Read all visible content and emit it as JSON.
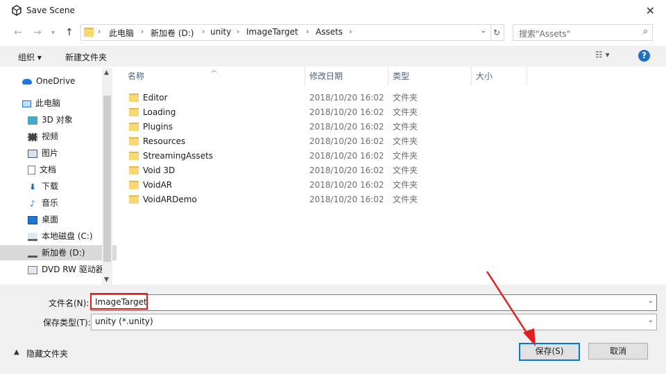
{
  "window": {
    "title": "Save Scene"
  },
  "addressbar": {
    "segments": [
      "此电脑",
      "新加卷 (D:)",
      "unity",
      "ImageTarget",
      "Assets"
    ],
    "search_placeholder": "搜索\"Assets\""
  },
  "toolbar": {
    "organize": "组织 ▾",
    "new_folder": "新建文件夹"
  },
  "sidebar": {
    "items": [
      {
        "label": "OneDrive"
      },
      {
        "label": "此电脑"
      },
      {
        "label": "3D 对象"
      },
      {
        "label": "视频"
      },
      {
        "label": "图片"
      },
      {
        "label": "文档"
      },
      {
        "label": "下载"
      },
      {
        "label": "音乐"
      },
      {
        "label": "桌面"
      },
      {
        "label": "本地磁盘 (C:)"
      },
      {
        "label": "新加卷 (D:)"
      },
      {
        "label": "DVD RW 驱动器"
      }
    ]
  },
  "list": {
    "headers": [
      "名称",
      "修改日期",
      "类型",
      "大小"
    ],
    "rows": [
      {
        "name": "Editor",
        "date": "2018/10/20 16:02",
        "type": "文件夹"
      },
      {
        "name": "Loading",
        "date": "2018/10/20 16:02",
        "type": "文件夹"
      },
      {
        "name": "Plugins",
        "date": "2018/10/20 16:02",
        "type": "文件夹"
      },
      {
        "name": "Resources",
        "date": "2018/10/20 16:02",
        "type": "文件夹"
      },
      {
        "name": "StreamingAssets",
        "date": "2018/10/20 16:02",
        "type": "文件夹"
      },
      {
        "name": "Void 3D",
        "date": "2018/10/20 16:02",
        "type": "文件夹"
      },
      {
        "name": "VoidAR",
        "date": "2018/10/20 16:02",
        "type": "文件夹"
      },
      {
        "name": "VoidARDemo",
        "date": "2018/10/20 16:02",
        "type": "文件夹"
      }
    ]
  },
  "form": {
    "filename_label": "文件名(N):",
    "filename_value": "ImageTarget",
    "filetype_label": "保存类型(T):",
    "filetype_value": "unity (*.unity)"
  },
  "footer": {
    "hide_folders": "隐藏文件夹",
    "save": "保存(S)",
    "cancel": "取消"
  },
  "colors": {
    "accent": "#0078d7",
    "highlight_box": "#e02020",
    "arrow": "#e02020"
  }
}
